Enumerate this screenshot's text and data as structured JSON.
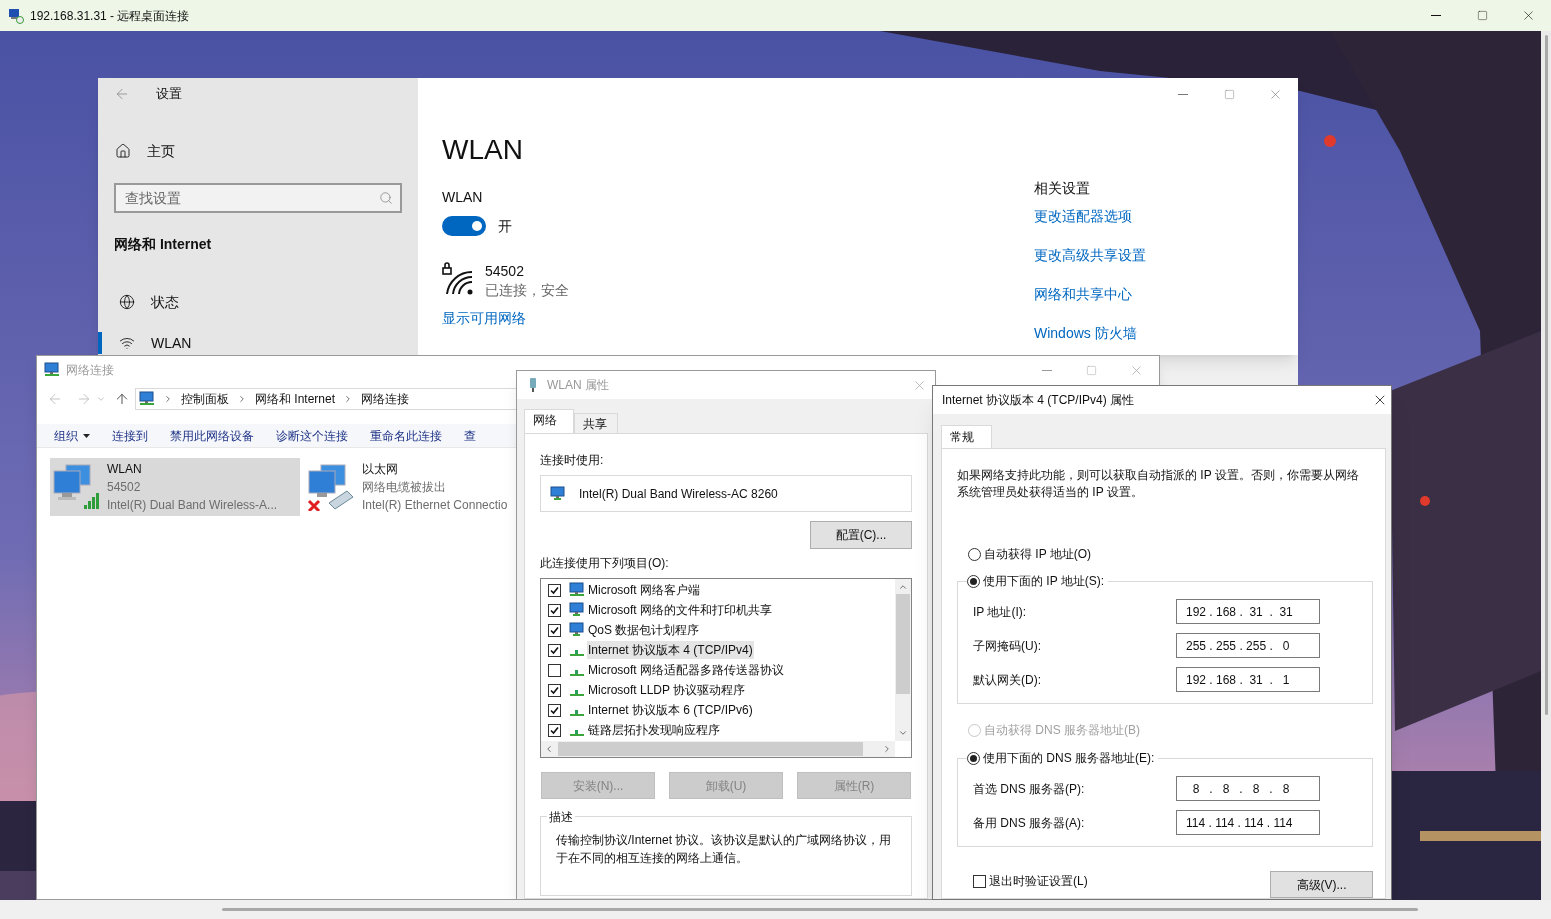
{
  "window": {
    "title": "192.168.31.31 - 远程桌面连接"
  },
  "settings": {
    "title": "设置",
    "home": "主页",
    "search": {
      "placeholder": "查找设置"
    },
    "section": "网络和 Internet",
    "nav": [
      {
        "label": "状态",
        "kind": "status",
        "selected": false
      },
      {
        "label": "WLAN",
        "kind": "wifi",
        "selected": true
      }
    ],
    "heading": "WLAN",
    "wlan_label": "WLAN",
    "toggle": {
      "on": true,
      "label": "开"
    },
    "network": {
      "name": "54502",
      "status": "已连接，安全"
    },
    "show_networks": "显示可用网络",
    "related": {
      "title": "相关设置",
      "links": [
        "更改适配器选项",
        "更改高级共享设置",
        "网络和共享中心",
        "Windows 防火墙"
      ]
    }
  },
  "connections": {
    "title": "网络连接",
    "breadcrumb": [
      "控制面板",
      "网络和 Internet",
      "网络连接"
    ],
    "toolbar": [
      {
        "label": "组织",
        "dropdown": true
      },
      {
        "label": "连接到",
        "dropdown": false
      },
      {
        "label": "禁用此网络设备",
        "dropdown": false
      },
      {
        "label": "诊断这个连接",
        "dropdown": false
      },
      {
        "label": "重命名此连接",
        "dropdown": false
      },
      {
        "label": "查",
        "dropdown": false
      }
    ],
    "adapters": [
      {
        "name": "WLAN",
        "status": "54502",
        "device": "Intel(R) Dual Band Wireless-A...",
        "kind": "wireless",
        "selected": true
      },
      {
        "name": "以太网",
        "status": "网络电缆被拔出",
        "device": "Intel(R) Ethernet Connectio",
        "kind": "ethernet",
        "selected": false
      }
    ]
  },
  "wlan_properties": {
    "title": "WLAN 属性",
    "tabs": [
      {
        "label": "网络",
        "selected": true
      },
      {
        "label": "共享",
        "selected": false
      }
    ],
    "connect_using_label": "连接时使用:",
    "adapter": "Intel(R) Dual Band Wireless-AC 8260",
    "configure_button": "配置(C)...",
    "items_label": "此连接使用下列项目(O):",
    "items": [
      {
        "label": "Microsoft 网络客户端",
        "kind": "client",
        "checked": true,
        "selected": false
      },
      {
        "label": "Microsoft 网络的文件和打印机共享",
        "kind": "service",
        "checked": true,
        "selected": false
      },
      {
        "label": "QoS 数据包计划程序",
        "kind": "service",
        "checked": true,
        "selected": false
      },
      {
        "label": "Internet 协议版本 4 (TCP/IPv4)",
        "kind": "protocol",
        "checked": true,
        "selected": true
      },
      {
        "label": "Microsoft 网络适配器多路传送器协议",
        "kind": "protocol",
        "checked": false,
        "selected": false
      },
      {
        "label": "Microsoft LLDP 协议驱动程序",
        "kind": "protocol",
        "checked": true,
        "selected": false
      },
      {
        "label": "Internet 协议版本 6 (TCP/IPv6)",
        "kind": "protocol",
        "checked": true,
        "selected": false
      },
      {
        "label": "链路层拓扑发现响应程序",
        "kind": "protocol",
        "checked": true,
        "selected": false
      }
    ],
    "buttons": [
      {
        "label": "安装(N)...",
        "disabled": true
      },
      {
        "label": "卸载(U)",
        "disabled": true
      },
      {
        "label": "属性(R)",
        "disabled": true
      }
    ],
    "description_title": "描述",
    "description": "传输控制协议/Internet 协议。该协议是默认的广域网络协议，用于在不同的相互连接的网络上通信。"
  },
  "ipv4": {
    "title": "Internet 协议版本 4 (TCP/IPv4) 属性",
    "tabs": [
      {
        "label": "常规",
        "selected": true
      }
    ],
    "intro": "如果网络支持此功能，则可以获取自动指派的 IP 设置。否则，你需要从网络系统管理员处获得适当的 IP 设置。",
    "ip_auto": {
      "label": "自动获得 IP 地址(O)",
      "selected": false,
      "disabled": false
    },
    "ip_manual": {
      "label": "使用下面的 IP 地址(S):",
      "selected": true,
      "disabled": false
    },
    "ip_fields": [
      {
        "label": "IP 地址(I):",
        "value": "192 . 168 .  31  .  31"
      },
      {
        "label": "子网掩码(U):",
        "value": "255 . 255 . 255 .   0"
      },
      {
        "label": "默认网关(D):",
        "value": "192 . 168 .  31  .   1"
      }
    ],
    "dns_auto": {
      "label": "自动获得 DNS 服务器地址(B)",
      "selected": false,
      "disabled": true
    },
    "dns_manual": {
      "label": "使用下面的 DNS 服务器地址(E):",
      "selected": true,
      "disabled": false
    },
    "dns_fields": [
      {
        "label": "首选 DNS 服务器(P):",
        "value": "  8   .   8   .   8   .   8"
      },
      {
        "label": "备用 DNS 服务器(A):",
        "value": "114 . 114 . 114 . 114"
      }
    ],
    "validate": {
      "label": "退出时验证设置(L)",
      "checked": false
    },
    "advanced_button": "高级(V)..."
  }
}
